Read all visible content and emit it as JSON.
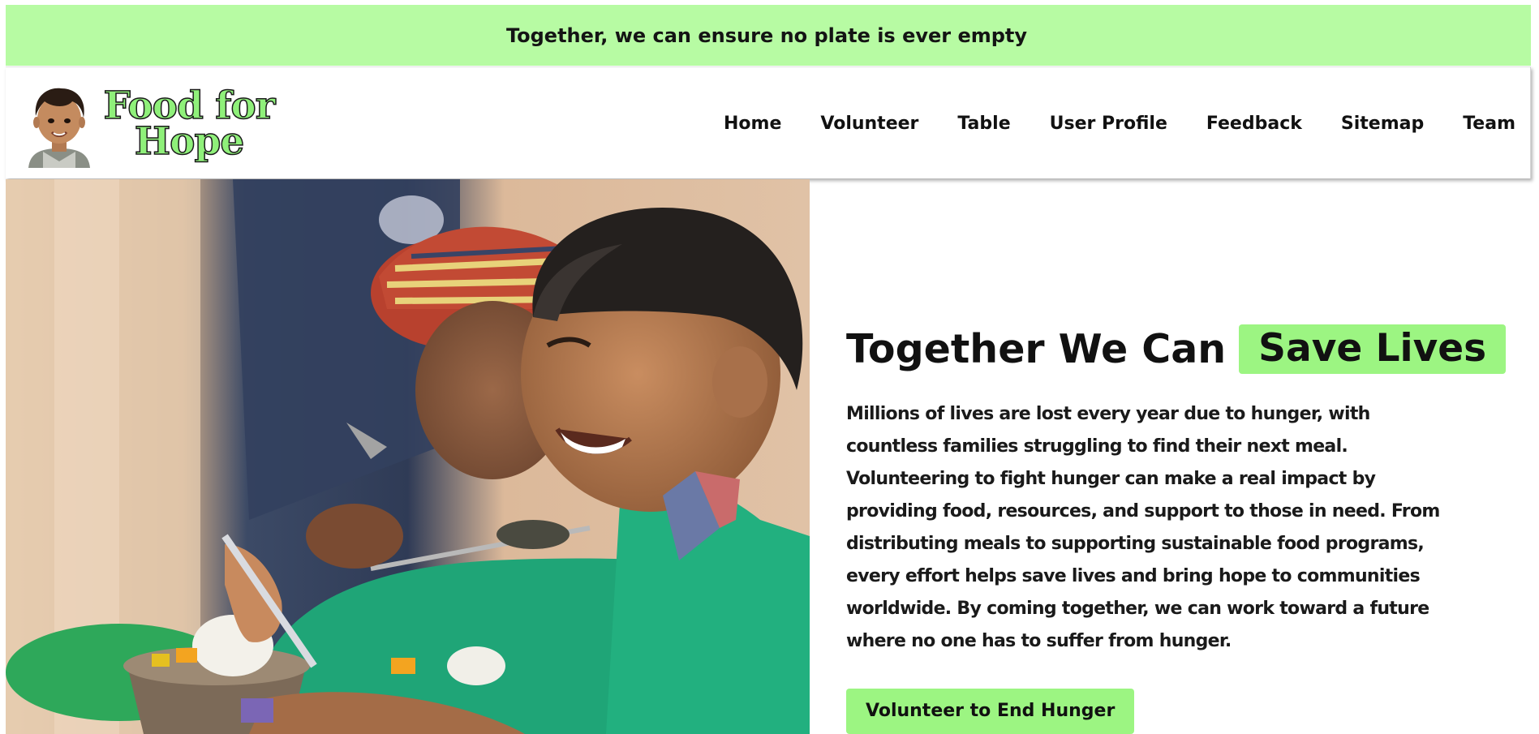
{
  "announcement": {
    "text": "Together, we can ensure no plate is ever empty"
  },
  "header": {
    "logo": {
      "line1": "Food for",
      "line2": "Hope"
    },
    "nav": [
      {
        "label": "Home"
      },
      {
        "label": "Volunteer"
      },
      {
        "label": "Table"
      },
      {
        "label": "User Profile"
      },
      {
        "label": "Feedback"
      },
      {
        "label": "Sitemap"
      },
      {
        "label": "Team"
      }
    ]
  },
  "hero": {
    "title_plain": "Together We Can",
    "title_highlight": "Save Lives",
    "description": "Millions of lives are lost every year due to hunger, with countless families struggling to find their next meal. Volunteering to fight hunger can make a real impact by providing food, resources, and support to those in need. From distributing meals to supporting sustainable food programs, every effort helps save lives and bring hope to communities worldwide. By coming together, we can work toward a future where no one has to suffer from hunger.",
    "cta_label": "Volunteer to End Hunger"
  },
  "colors": {
    "accent": "#b7fba3",
    "highlight": "#9cf582",
    "text": "#111111"
  }
}
